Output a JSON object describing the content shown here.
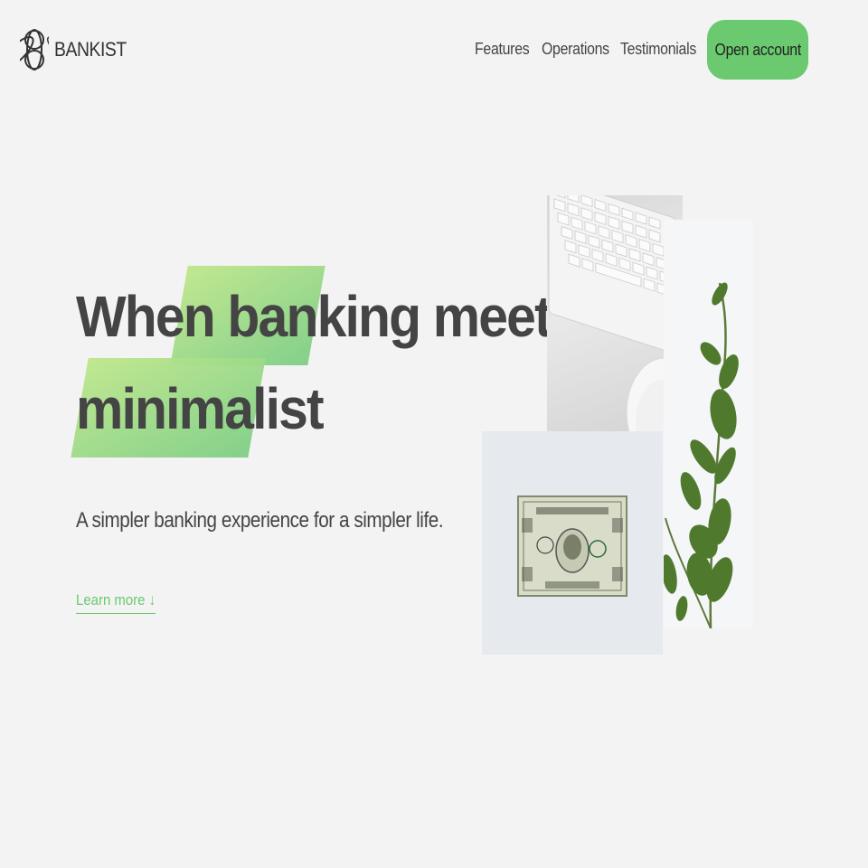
{
  "brand": {
    "name": "BANKIST",
    "accent_color": "#6bc96f"
  },
  "nav": {
    "links": [
      "Features",
      "Operations",
      "Testimonials"
    ],
    "cta": "Open account"
  },
  "hero": {
    "title_line1_pre": "When ",
    "title_line1_highlight": "banking",
    "title_line1_post": " meets",
    "title_line2": "minimalist",
    "subtitle": "A simpler banking experience for a simpler life.",
    "learn_more": "Learn more ↓"
  },
  "images": {
    "keyboard": "keyboard-mouse-image",
    "plant": "eucalyptus-plant-image",
    "dollar": "dollar-bill-image"
  }
}
